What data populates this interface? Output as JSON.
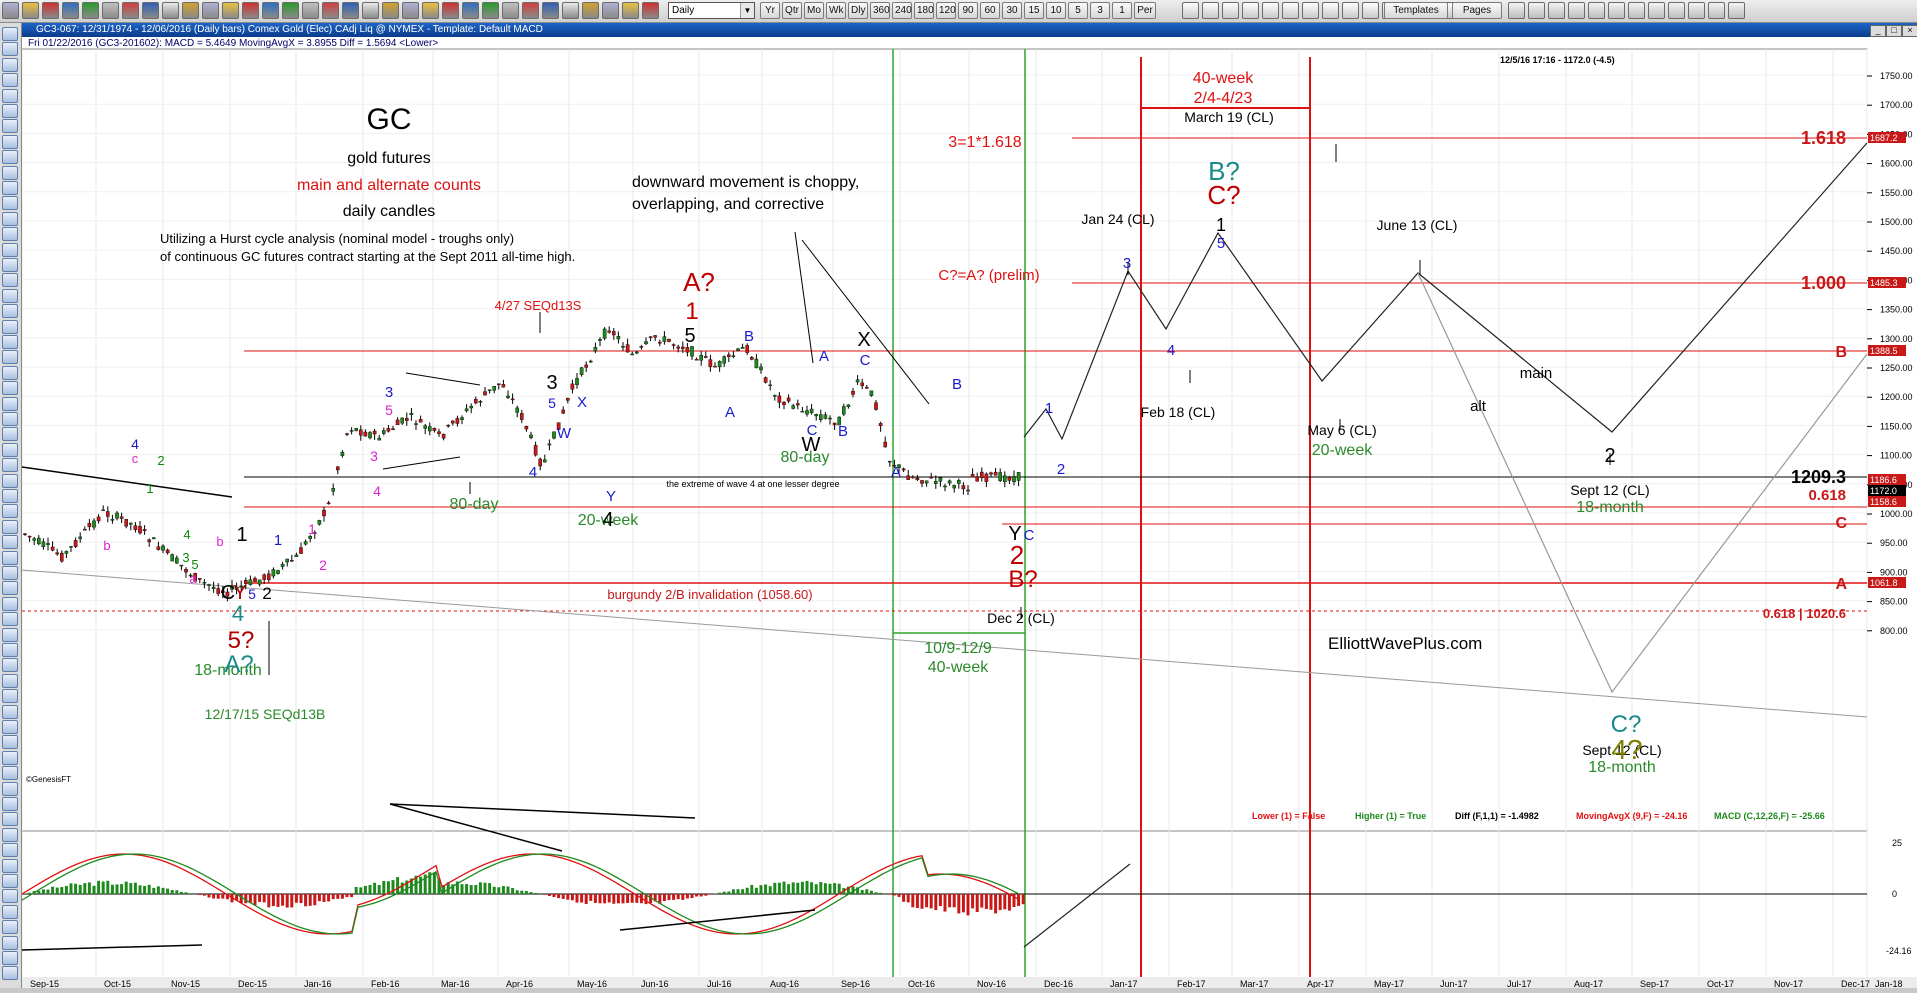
{
  "toolbar": {
    "symbol_value": "Daily",
    "timeframes": [
      "Yr",
      "Qtr",
      "Mo",
      "Wk",
      "Dly",
      "360",
      "240",
      "180",
      "120",
      "90",
      "60",
      "30",
      "15",
      "10",
      "5",
      "3",
      "1",
      "Per"
    ],
    "templates_label": "Templates",
    "pages_label": "Pages"
  },
  "title_bar": {
    "title": "GC3-067:  12/31/1974 - 12/06/2016  (Daily bars)    Comex Gold (Elec) CAdj Liq @ NYMEX    -  Template: Default MACD"
  },
  "chart": {
    "header_line": "Fri   01/22/2016 (GC3-201602):  MACD = 5.4649  MovingAvgX = 3.8955  Diff = 1.5694  <Lower>",
    "timestamp": "12/5/16 17:16 - 1172.0 (-4.5)",
    "genesis_label": "©GenesisFT",
    "watermark": "ElliottWavePlus.com",
    "title_lines": {
      "symbol": "GC",
      "subtitle": "gold futures",
      "counts": "main and alternate counts",
      "candles": "daily candles",
      "hurst1": "Utilizing a Hurst cycle analysis (nominal model - troughs only)",
      "hurst2": "of continuous GC futures contract starting at the Sept 2011 all-time high."
    },
    "annotations": {
      "downward1": "downward movement is choppy,",
      "downward2": "overlapping, and corrective",
      "seq_4_27": "4/27 SEQd13S",
      "seq_12_17": "12/17/15 SEQd13B",
      "ratio_label": "3=1*1.618",
      "prelim": "C?=A? (prelim)",
      "invalidation": "burgundy 2/B invalidation (1058.60)",
      "extreme": "the extreme of wave 4 at one lesser degree",
      "forty_week_a": "40-week",
      "forty_week_dates": "2/4-4/23",
      "date_range_a": "10/9-12/9",
      "date_range_b": "40-week",
      "jan24": "Jan 24 (CL)",
      "feb18": "Feb 18 (CL)",
      "march19": "March 19 (CL)",
      "may6": "May 6 (CL)",
      "may6_cycle": "20-week",
      "june13": "June 13 (CL)",
      "dec2": "Dec 2 (CL)",
      "sept12_a": "Sept 12 (CL)",
      "sept12_a_cycle": "18-month",
      "sept12_b": "Sept 12 (CL)",
      "sept12_b_cycle": "18-month",
      "main": "main",
      "alt": "alt",
      "eighty_day_1": "80-day",
      "eighty_day_2": "80-day",
      "twenty_week": "20-week",
      "eighteen_month": "18-month"
    },
    "levels": {
      "lvl_1618": "1.618",
      "lvl_1000": "1.000",
      "lvl_B": "B",
      "lvl_12093": "1209.3",
      "lvl_0618": "0.618",
      "lvl_C": "C",
      "lvl_A": "A",
      "lvl_0618b": "0.618 | 1020.6"
    },
    "price_tags": {
      "p1687": "1687.2",
      "p1485": "1485.3",
      "p1388": "1388.5",
      "p1186": "1186.6",
      "p1172": "1172.0",
      "p1158": "1158.6",
      "p1061": "1061.8"
    },
    "price_axis": [
      "1750.00",
      "1700.00",
      "1650.00",
      "1600.00",
      "1550.00",
      "1500.00",
      "1450.00",
      "1400.00",
      "1350.00",
      "1300.00",
      "1250.00",
      "1200.00",
      "1150.00",
      "1100.00",
      "1050.00",
      "1000.00",
      "950.00",
      "900.00",
      "850.00",
      "800.00"
    ],
    "macd_axis": [
      "25",
      "0",
      "-24.16"
    ],
    "macd_legend": {
      "lower": "Lower (1) = False",
      "higher": "Higher (1) = True",
      "diff": "Diff (F,1,1) = -1.4982",
      "mavg": "MovingAvgX (9,F) = -24.16",
      "macd": "MACD (C,12,26,F) = -25.66"
    },
    "date_axis": [
      "Sep-15",
      "Oct-15",
      "Nov-15",
      "Dec-15",
      "Jan-16",
      "Feb-16",
      "Mar-16",
      "Apr-16",
      "May-16",
      "Jun-16",
      "Jul-16",
      "Aug-16",
      "Sep-16",
      "Oct-16",
      "Nov-16",
      "Dec-16",
      "Jan-17",
      "Feb-17",
      "Mar-17",
      "Apr-17",
      "May-17",
      "Jun-17",
      "Jul-17",
      "Aug-17",
      "Sep-17",
      "Oct-17",
      "Nov-17",
      "Dec-17",
      "Jan-18"
    ]
  },
  "wave_labels": [
    {
      "t": "4",
      "c": "#1a1ad0"
    },
    {
      "t": "c",
      "c": "#e020d0"
    },
    {
      "t": "2",
      "c": "#0a8a0a"
    },
    {
      "t": "1",
      "c": "#0a8a0a"
    },
    {
      "t": "b",
      "c": "#e020d0"
    },
    {
      "t": "4",
      "c": "#0a8a0a"
    },
    {
      "t": "3",
      "c": "#0a8a0a"
    },
    {
      "t": "5",
      "c": "#0a8a0a"
    },
    {
      "t": "a",
      "c": "#e020d0"
    },
    {
      "t": "b",
      "c": "#e020d0"
    },
    {
      "t": "1",
      "c": "#000000"
    },
    {
      "t": "C",
      "c": "#000000"
    },
    {
      "t": "Y",
      "c": "#b00000"
    },
    {
      "t": "5",
      "c": "#1a1ad0"
    },
    {
      "t": "2",
      "c": "#000000"
    },
    {
      "t": "4",
      "c": "#1a8a8a"
    },
    {
      "t": "5?",
      "c": "#b00000"
    },
    {
      "t": "A?",
      "c": "#1a8a8a"
    },
    {
      "t": "1",
      "c": "#1a1ad0"
    },
    {
      "t": "1",
      "c": "#e020d0"
    },
    {
      "t": "2",
      "c": "#e020d0"
    },
    {
      "t": "3",
      "c": "#1a1ad0"
    },
    {
      "t": "5",
      "c": "#e020d0"
    },
    {
      "t": "3",
      "c": "#e020d0"
    },
    {
      "t": "4",
      "c": "#e020d0"
    },
    {
      "t": "3",
      "c": "#000000"
    },
    {
      "t": "5",
      "c": "#1a1ad0"
    },
    {
      "t": "X",
      "c": "#1a1ad0"
    },
    {
      "t": "W",
      "c": "#1a1ad0"
    },
    {
      "t": "4",
      "c": "#1a1ad0"
    },
    {
      "t": "Y",
      "c": "#1a1ad0"
    },
    {
      "t": "4",
      "c": "#000000"
    },
    {
      "t": "A?",
      "c": "#c00000"
    },
    {
      "t": "1",
      "c": "#c00000"
    },
    {
      "t": "5",
      "c": "#000000"
    },
    {
      "t": "B",
      "c": "#1a1ad0"
    },
    {
      "t": "A",
      "c": "#1a1ad0"
    },
    {
      "t": "A",
      "c": "#1a1ad0"
    },
    {
      "t": "C",
      "c": "#1a1ad0"
    },
    {
      "t": "W",
      "c": "#000000"
    },
    {
      "t": "B",
      "c": "#1a1ad0"
    },
    {
      "t": "X",
      "c": "#000000"
    },
    {
      "t": "C",
      "c": "#1a1ad0"
    },
    {
      "t": "B",
      "c": "#1a1ad0"
    },
    {
      "t": "A",
      "c": "#1a1ad0"
    },
    {
      "t": "Y",
      "c": "#000000"
    },
    {
      "t": "C",
      "c": "#1a1ad0"
    },
    {
      "t": "2",
      "c": "#c00000"
    },
    {
      "t": "B?",
      "c": "#c00000"
    },
    {
      "t": "1",
      "c": "#1a1ad0"
    },
    {
      "t": "2",
      "c": "#1a1ad0"
    },
    {
      "t": "3",
      "c": "#1a1ad0"
    },
    {
      "t": "4",
      "c": "#1a1ad0"
    },
    {
      "t": "B?",
      "c": "#1a8a8a"
    },
    {
      "t": "C?",
      "c": "#c00000"
    },
    {
      "t": "1",
      "c": "#000000"
    },
    {
      "t": "5",
      "c": "#1a1ad0"
    },
    {
      "t": "2",
      "c": "#000000"
    },
    {
      "t": "C?",
      "c": "#1a8a8a"
    },
    {
      "t": "4?",
      "c": "#808000"
    }
  ]
}
